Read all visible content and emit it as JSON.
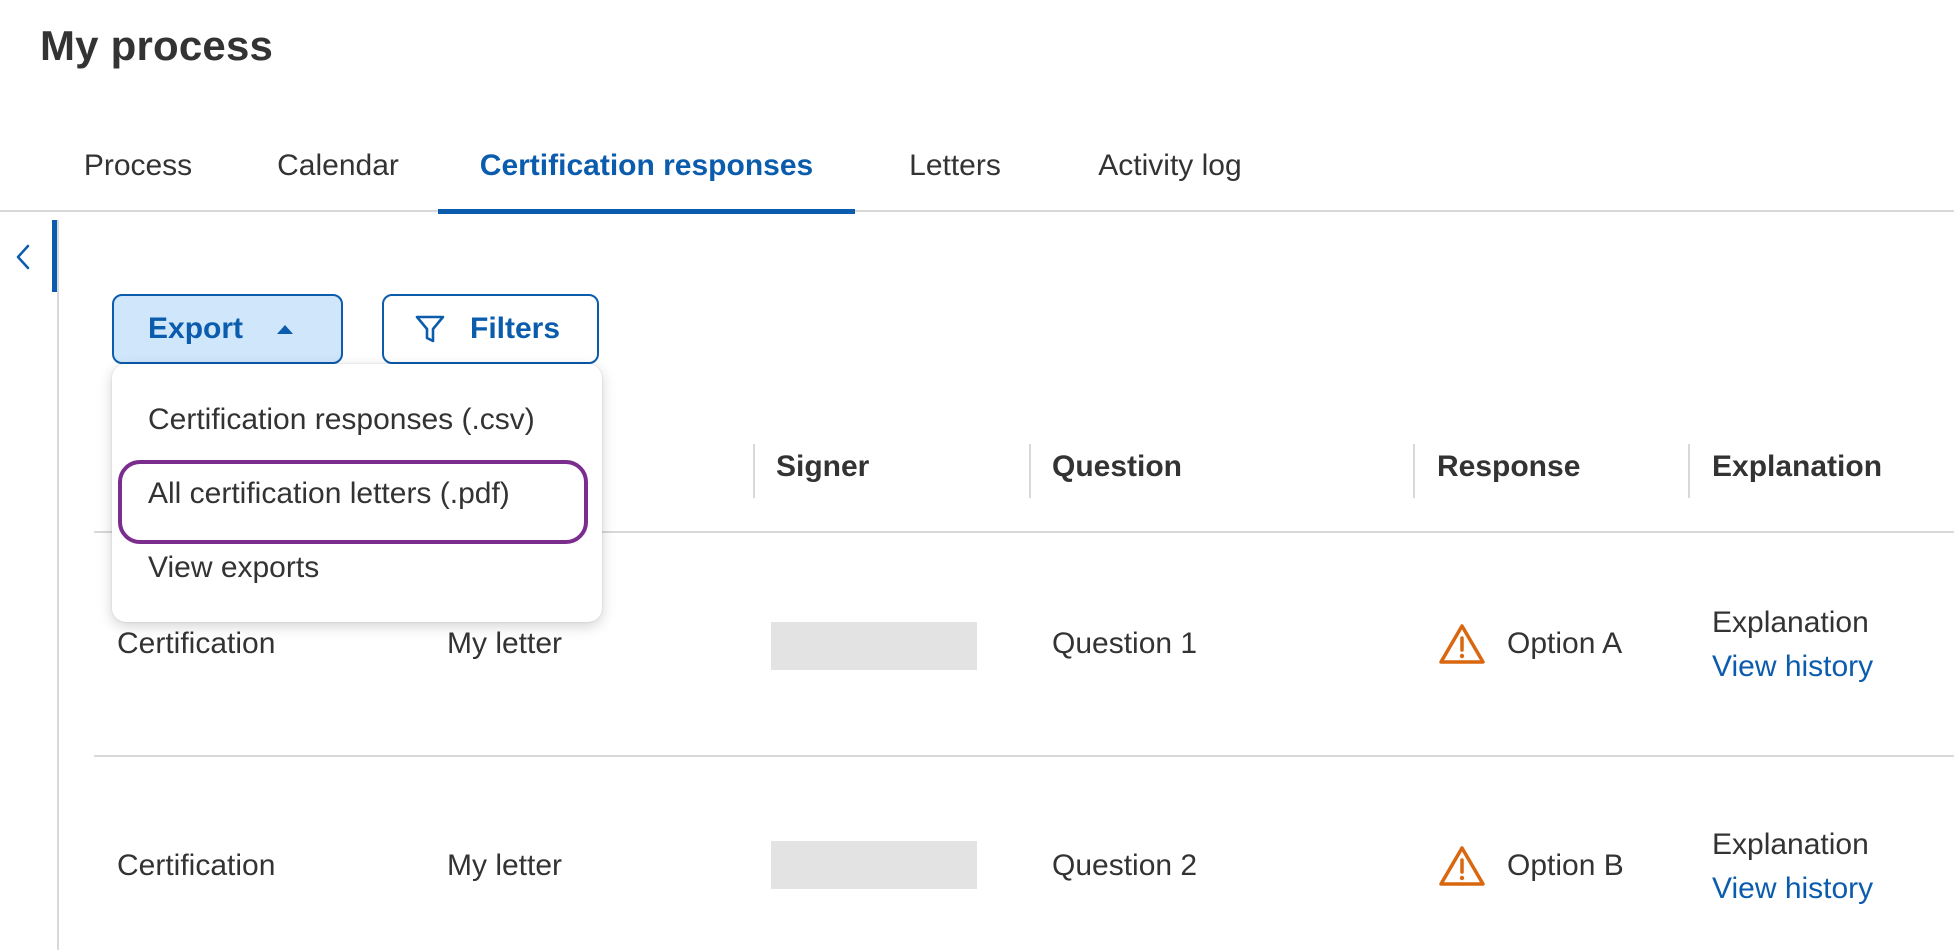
{
  "page": {
    "title": "My process"
  },
  "tabs": [
    {
      "label": "Process",
      "active": false
    },
    {
      "label": "Calendar",
      "active": false
    },
    {
      "label": "Certification responses",
      "active": true
    },
    {
      "label": "Letters",
      "active": false
    },
    {
      "label": "Activity log",
      "active": false
    }
  ],
  "sidebar": {
    "toggle_icon": "chevron-left-icon"
  },
  "toolbar": {
    "export_label": "Export",
    "export_icon": "caret-up-icon",
    "filters_label": "Filters",
    "filters_icon": "filter-icon"
  },
  "export_menu": {
    "items": [
      {
        "label": "Certification responses (.csv)",
        "highlighted": false
      },
      {
        "label": "All certification letters (.pdf)",
        "highlighted": true
      },
      {
        "label": "View exports",
        "highlighted": false
      }
    ],
    "highlight_color": "#7b2d8e"
  },
  "table": {
    "columns": [
      "Signer",
      "Question",
      "Response",
      "Explanation"
    ],
    "rows": [
      {
        "type": "Certification",
        "letter": "My letter",
        "signer": "",
        "question": "Question 1",
        "response": "Option A",
        "response_icon": "warning-icon",
        "explanation": "Explanation",
        "history_link": "View history"
      },
      {
        "type": "Certification",
        "letter": "My letter",
        "signer": "",
        "question": "Question 2",
        "response": "Option B",
        "response_icon": "warning-icon",
        "explanation": "Explanation",
        "history_link": "View history"
      }
    ]
  },
  "colors": {
    "accent": "#0b5cad",
    "export_button_bg": "#cfe6fb",
    "warning": "#d9670f",
    "divider": "#d9d9d9",
    "text": "#333333"
  }
}
